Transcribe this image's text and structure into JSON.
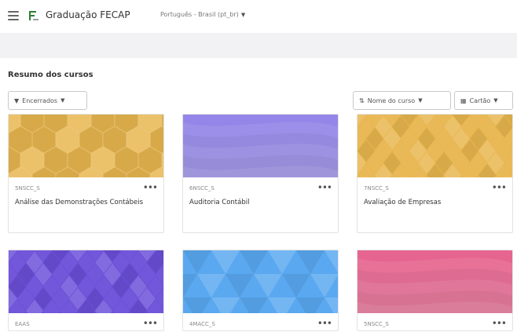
{
  "header": {
    "site_title": "Graduação FECAP",
    "language": "Português - Brasil (pt_br)"
  },
  "courses": {
    "heading": "Resumo dos cursos",
    "filter_label": "Encerrados",
    "sort_label": "Nome do curso",
    "view_label": "Cartão",
    "cards": [
      {
        "code": "5NSCC_S",
        "name": "Análise das Demonstrações Contábeis",
        "image_color": "#e8b64e",
        "pattern": "hexagons"
      },
      {
        "code": "6NSCC_S",
        "name": "Auditoria Contábil",
        "image_color": "#9b8cf2",
        "pattern": "waves"
      },
      {
        "code": "7NSCC_S",
        "name": "Avaliação de Empresas",
        "image_color": "#e8b64e",
        "pattern": "diamonds"
      },
      {
        "code": "EAAS",
        "name": "",
        "image_color": "#6b4fd8",
        "pattern": "diamonds"
      },
      {
        "code": "4MACC_S",
        "name": "",
        "image_color": "#5aa8f0",
        "pattern": "triangles"
      },
      {
        "code": "5NSCC_S",
        "name": "",
        "image_color": "#f06a96",
        "pattern": "waves"
      }
    ]
  }
}
